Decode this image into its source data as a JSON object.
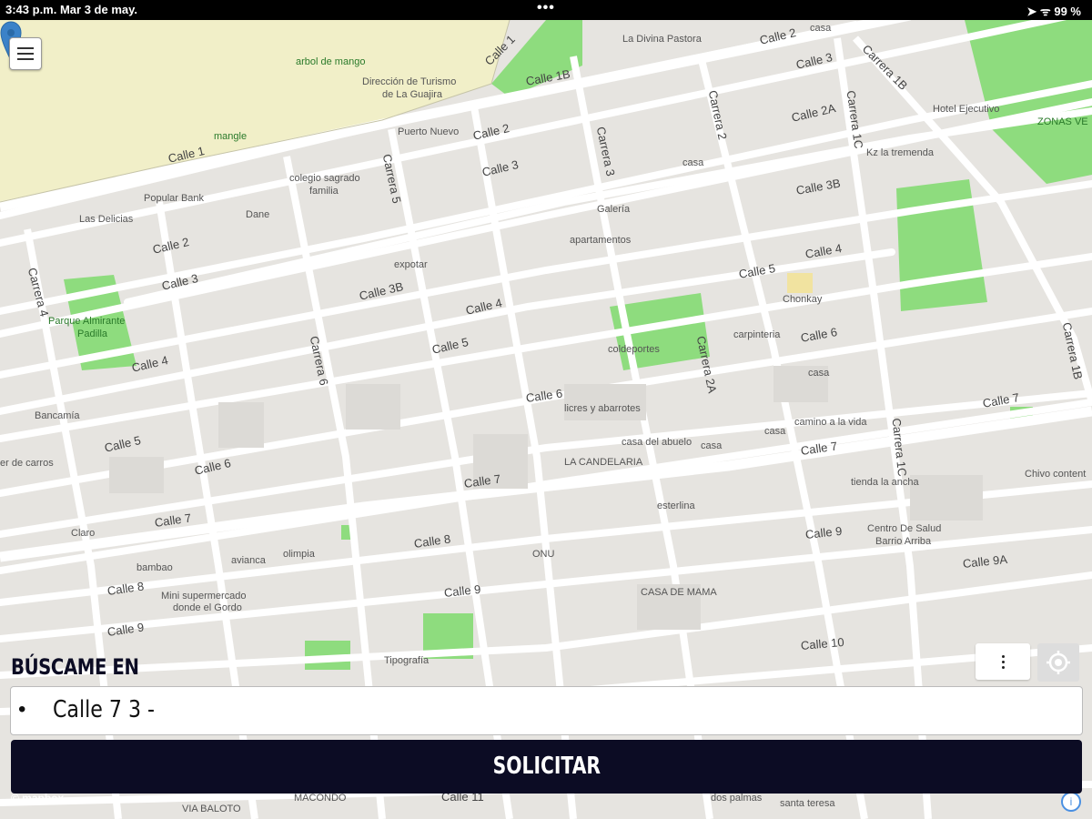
{
  "status_bar": {
    "time_date": "3:43 p.m.   Mar 3 de may.",
    "dots": "•••",
    "right": "➤ ᯤ 99 %"
  },
  "map": {
    "roads": {
      "calle1_a": "Calle 1",
      "calle1_b": "Calle 1",
      "calle1b": "Calle 1B",
      "calle2_a": "Calle 2",
      "calle2_b": "Calle 2",
      "calle2_c": "Calle 2",
      "calle2a": "Calle 2A",
      "calle3_a": "Calle 3",
      "calle3_b": "Calle 3",
      "calle3_c": "Calle 3",
      "calle3b_a": "Calle 3B",
      "calle3b_b": "Calle 3B",
      "calle4_a": "Calle 4",
      "calle4_b": "Calle 4",
      "calle4_c": "Calle 4",
      "calle5_a": "Calle 5",
      "calle5_b": "Calle 5",
      "calle5_c": "Calle 5",
      "calle6_a": "Calle 6",
      "calle6_b": "Calle 6",
      "calle6_c": "Calle 6",
      "calle7_a": "Calle 7",
      "calle7_b": "Calle 7",
      "calle7_c": "Calle 7",
      "calle7_d": "Calle 7",
      "calle8_a": "Calle 8",
      "calle8_b": "Calle 8",
      "calle9_a": "Calle 9",
      "calle9_b": "Calle 9",
      "calle9_c": "Calle 9",
      "calle9a": "Calle 9A",
      "calle10": "Calle 10",
      "calle11": "Calle 11",
      "carrera4": "Carrera 4",
      "carrera5": "Carrera 5",
      "carrera6": "Carrera 6",
      "carrera3": "Carrera 3",
      "carrera2": "Carrera 2",
      "carrera2a": "Carrera 2A",
      "carrera1c_a": "Carrera 1C",
      "carrera1c_b": "Carrera 1C",
      "carrera1b_a": "Carrera 1B",
      "carrera1b_b": "Carrera 1B"
    },
    "pois": {
      "arbol": "arbol de mango",
      "direccion1": "Dirección de Turismo",
      "direccion2": "de La Guajira",
      "manglе": "mangle",
      "divina": "La Divina Pastora",
      "casa1": "casa",
      "puerto": "Puerto Nuevo",
      "hotel": "Hotel Ejecutivo",
      "zonas": "ZONAS VE",
      "popular": "Popular Bank",
      "dane": "Dane",
      "colegio1": "colegio sagrado",
      "colegio2": "familia",
      "casa2": "casa",
      "latremenda": "Kz la tremenda",
      "delicias": "Las Delicias",
      "galeria": "Galería",
      "apartamentos": "apartamentos",
      "expotar": "expotar",
      "parque1": "Parque Almirante",
      "parque2": "Padilla",
      "chonkay": "Chonkay",
      "coldeportes": "coldeportes",
      "carpinteria": "carpinteria",
      "casa3": "casa",
      "bancamia": "Bancamía",
      "licores": "licres y abarrotes",
      "casa4": "casa",
      "camino": "camino a la vida",
      "abuelo": "casa del abuelo",
      "casa5": "casa",
      "carros": "er de carros",
      "candelaria": "LA CANDELARIA",
      "tienda": "tienda la ancha",
      "chivo": "Chivo content",
      "esterlina": "esterlina",
      "claro": "Claro",
      "centro1": "Centro De Salud",
      "centro2": "Barrio Arriba",
      "avianca": "avianca",
      "olimpia": "olimpia",
      "onu": "ONU",
      "bambao": "bambao",
      "mini1": "Mini supermercado",
      "mini2": "donde el Gordo",
      "casamama": "CASA DE MAMA",
      "tipografia": "Tipografía",
      "baloto": "VIA BALOTO",
      "macondo": "MACONDO",
      "palmas": "dos palmas",
      "santa": "santa teresa"
    },
    "mapbox": "© mapbox",
    "info": "i"
  },
  "panel": {
    "heading": "BÚSCAME EN",
    "bullet": "•",
    "address": "Calle 7 3 -",
    "more": "",
    "submit": "SOLICITAR"
  },
  "colors": {
    "primary": "#0c0c24",
    "map_bg": "#e6e4e0",
    "park": "#8edc7e",
    "sand": "#f1efc8",
    "pin": "#3b82c8"
  }
}
